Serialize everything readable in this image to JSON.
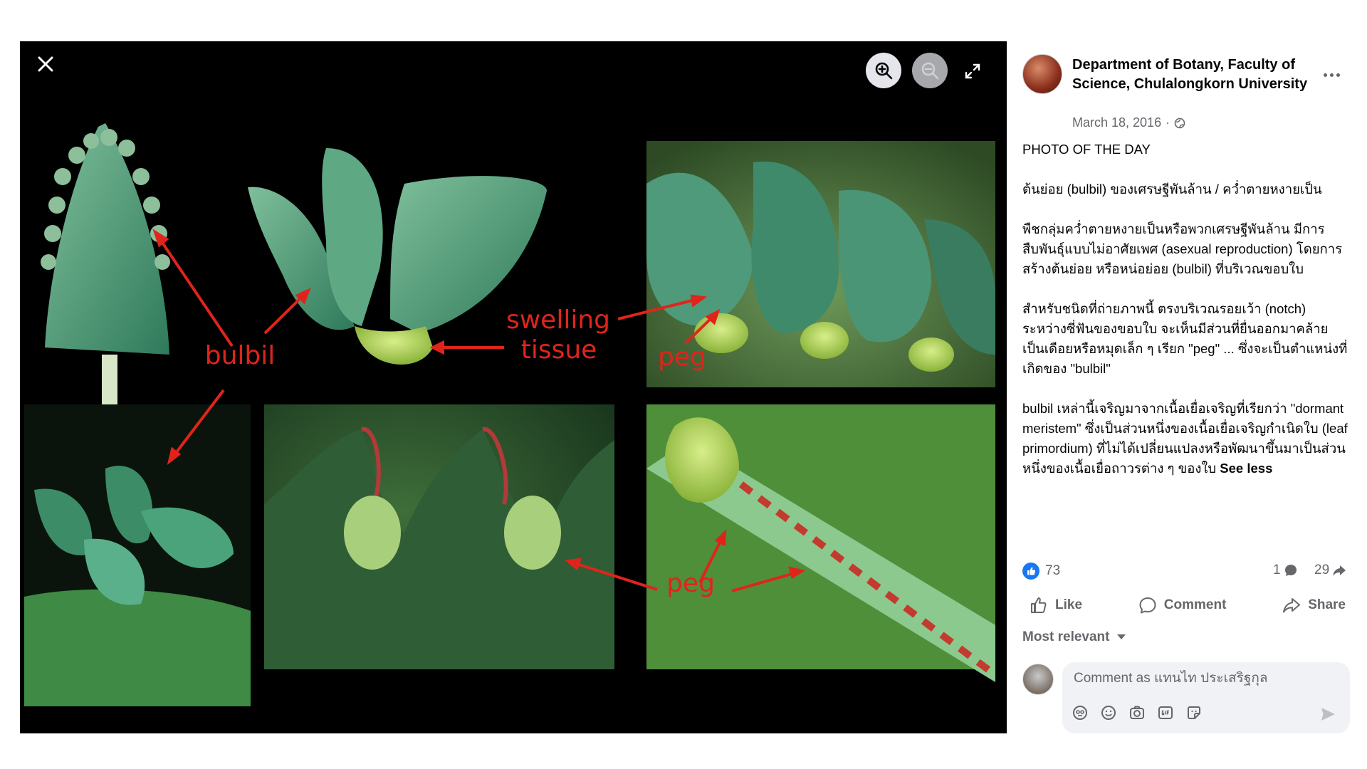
{
  "photo": {
    "annotations": {
      "bulbil": "bulbil",
      "swelling_line1": "swelling",
      "swelling_line2": "tissue",
      "peg_top": "peg",
      "peg_bottom": "peg"
    }
  },
  "post": {
    "page_name": "Department of Botany, Faculty of Science, Chulalongkorn University",
    "date": "March 18, 2016",
    "date_separator": "·",
    "paragraphs": [
      "PHOTO OF THE DAY",
      "ต้นย่อย (bulbil) ของเศรษฐีพันล้าน / คว่ำตายหงายเป็น",
      "พืชกลุ่มคว่ำตายหงายเป็นหรือพวกเศรษฐีพันล้าน มีการสืบพันธุ์แบบไม่อาศัยเพศ (asexual reproduction) โดยการสร้างต้นย่อย หรือหน่อย่อย (bulbil) ที่บริเวณขอบใบ",
      "สำหรับชนิดที่ถ่ายภาพนี้ ตรงบริเวณรอยเว้า (notch) ระหว่างซี่ฟันของขอบใบ จะเห็นมีส่วนที่ยื่นออกมาคล้ายเป็นเดือยหรือหมุดเล็ก ๆ เรียก \"peg\" ... ซึ่งจะเป็นตำแหน่งที่เกิดของ \"bulbil\""
    ],
    "last_paragraph": "bulbil เหล่านี้เจริญมาจากเนื้อเยื่อเจริญที่เรียกว่า \"dormant meristem\" ซึ่งเป็นส่วนหนึ่งของเนื้อเยื่อเจริญกำเนิดใบ (leaf primordium) ที่ไม่ได้เปลี่ยนแปลงหรือพัฒนาขึ้นมาเป็นส่วนหนึ่งของเนื้อเยื่อถาวรต่าง ๆ ของใบ",
    "see_less": "See less"
  },
  "stats": {
    "likes": "73",
    "comments": "1",
    "shares": "29"
  },
  "actions": {
    "like": "Like",
    "comment": "Comment",
    "share": "Share"
  },
  "sort": {
    "label": "Most relevant"
  },
  "composer": {
    "placeholder": "Comment as แทนไท ประเสริฐกุล"
  },
  "icons": {
    "close": "close-icon",
    "zoom_in": "zoom-in-icon",
    "zoom_out": "zoom-out-icon",
    "fullscreen": "fullscreen-icon",
    "globe": "globe-icon",
    "more": "more-icon",
    "like": "thumbs-up-icon",
    "comment": "comment-icon",
    "share": "share-icon",
    "avatar_sticker": "avatar-sticker-icon",
    "emoji": "emoji-icon",
    "camera": "camera-icon",
    "gif": "gif-icon",
    "sticker": "sticker-icon",
    "send": "send-icon"
  },
  "colors": {
    "annotation_red": "#e0241b",
    "facebook_blue": "#1877f2",
    "secondary_text": "#65676b"
  }
}
